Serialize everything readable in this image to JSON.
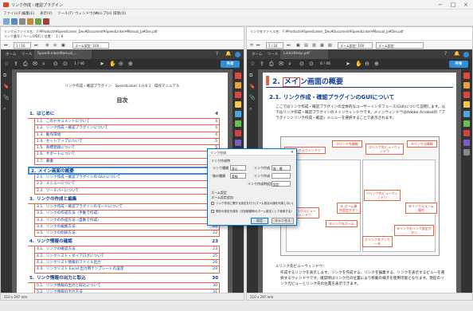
{
  "app": {
    "title": "リンク作成・確認プラグイン",
    "window_controls": [
      "−",
      "□",
      "×"
    ]
  },
  "menu": [
    "ファイル(F)",
    "編集(E)",
    "表示(V)",
    "ツール(T)",
    "ウィンドウ(W)",
    "ヘルプ(H)",
    "環境(O)"
  ],
  "left": {
    "info": [
      "リンク元ファイル名： F:¥Products¥SpeedLinker_Dev¥Document¥SpeedLinker¥Manual_Ja¥Dev.pdf",
      "リンク番号 / ページ(PDF) / 位置 ： 1 / 8"
    ],
    "nav": {
      "page_box": "1 / 16",
      "zoom": "ズーム設定: 100"
    },
    "tabs": {
      "home": "ホーム",
      "tools": "ツール",
      "doc": "SpeedLinkerManual_..."
    },
    "toolbar": {
      "page": "1 / 46",
      "share": "共有"
    },
    "page": {
      "header": "リンク作成・確認プラグイン　SpeedLinker 1.0.6.1　操作マニュアル",
      "toc_title": "目次",
      "toc": [
        {
          "num": "1.",
          "text": "はじめに",
          "page": "4",
          "level": 1
        },
        {
          "num": "1.1.",
          "text": "このドキュメントについて",
          "page": "4",
          "level": 2
        },
        {
          "num": "1.2.",
          "text": "リンク作成・確認プラグインについて",
          "page": "4",
          "level": 2
        },
        {
          "num": "1.3.",
          "text": "動作環境",
          "page": "4",
          "level": 2
        },
        {
          "num": "1.4.",
          "text": "セットアップについて",
          "page": "5",
          "level": 2
        },
        {
          "num": "1.5.",
          "text": "商標登録について",
          "page": "5",
          "level": 2
        },
        {
          "num": "1.6.",
          "text": "サポートについて",
          "page": "5",
          "level": 2
        },
        {
          "num": "1.7.",
          "text": "著書",
          "page": "5",
          "level": 2
        },
        {
          "num": "2.",
          "text": "メイン画面の概要",
          "page": "6",
          "level": 1
        },
        {
          "num": "2.1.",
          "text": "リンク作成・確認プラグインの GUI について",
          "page": "7",
          "level": 2
        },
        {
          "num": "2.2.",
          "text": "メニューについて",
          "page": "11",
          "level": 2
        },
        {
          "num": "2.3.",
          "text": "ツールバーについて",
          "page": "13",
          "level": 2
        },
        {
          "num": "3.",
          "text": "リンクの作成と編集",
          "page": "16",
          "level": 1
        },
        {
          "num": "3.1.",
          "text": "リンク作成・確認プラグインのモードについて",
          "page": "16",
          "level": 2
        },
        {
          "num": "3.2.",
          "text": "リンクの作成方法（手動で作成）",
          "page": "16",
          "level": 2
        },
        {
          "num": "3.3.",
          "text": "リンクの作成方法（自動で作成）",
          "page": "18",
          "level": 2
        },
        {
          "num": "3.4.",
          "text": "リンクの編集方法",
          "page": "20",
          "level": 2
        },
        {
          "num": "3.5.",
          "text": "リンクの削除方法",
          "page": "22",
          "level": 2
        },
        {
          "num": "4.",
          "text": "リンク情報の確認",
          "page": "23",
          "level": 1
        },
        {
          "num": "4.1.",
          "text": "リンクの確認方法",
          "page": "23",
          "level": 2
        },
        {
          "num": "4.2.",
          "text": "リンクリスト・ダイアログについて",
          "page": "25",
          "level": 2
        },
        {
          "num": "4.3.",
          "text": "リンクリスト情報のファイル出力",
          "page": "26",
          "level": 2
        },
        {
          "num": "4.4.",
          "text": "リンクリスト Excel 出力用テンプレートの設定",
          "page": "29",
          "level": 2
        },
        {
          "num": "5.",
          "text": "リンク情報の出力と取込",
          "page": "30",
          "level": 1
        },
        {
          "num": "5.1.",
          "text": "リンク情報の出力と取込について",
          "page": "30",
          "level": 2
        },
        {
          "num": "5.2.",
          "text": "リンク情報の出力方法",
          "page": "31",
          "level": 2
        }
      ]
    },
    "status": "210 x 297 mm"
  },
  "right": {
    "info": [
      "リンク先ファイル名： F:¥Products¥SpeedLinker_Dev¥Document¥SpeedLinker¥Manual_Ja¥Dev.pdf"
    ],
    "nav": {
      "page_box": "1 / 16",
      "zoom": "ズーム設定: 100",
      "zoom2": "ズーム設定"
    },
    "tabs": {
      "home": "ホーム",
      "tools": "ツール",
      "doc": "LinkUIHelp.pdf"
    },
    "toolbar": {
      "page": "6 / 46",
      "share": "共有"
    },
    "page": {
      "h1_num": "2.",
      "h1_boxed": "メイ",
      "h1_rest": "ン画面の概要",
      "h2": "2.1. リンク作成・確認プラグインのGUIについて",
      "para": "ここではリンク作成・確認プラグインの全体的なユーザーインタフェース(GUI)について説明します。以下はリンク作成・確認プラグインのメインウィンドウです。メインウィンドウはAdobe Acrobatの「プラグイン＞リンク作成・確認」メニューを選択することで表示されます。",
      "callouts": [
        "①リンク先情報",
        "③リンク元ウィンドウ",
        "②リンク先ビューウィンドウ",
        "④リンク元情報",
        "⑤リンク元ビューウィンドウ",
        "⑥ ズーム操作設定ボタン",
        "⑦リンク先ビューウィンドウ",
        "⑧リンク元ズーム操作",
        "⑨リンク先ズーム",
        "⑩リンク先リンク設定ボタン",
        "⑪リンク先アンカー名"
      ],
      "bullets_title": "①リンク先ビューウィンドウ：",
      "bullets": "作成するリンクを表示します。リンクを作成する、リンクを編集する、リンクを表示するビューを選択するウィンドウです。確認時はリンク元の位置により移動の様子を使用可能となります。現在のリンク元ビューとリンク先の位置を表示できます。"
    },
    "status": "210 x 297 mm"
  },
  "dialog": {
    "title": "リンク作成",
    "group1": "リンク作成時",
    "row1_label": "リンク種類",
    "row1_value": "表示",
    "row1b_label": "リンク作成",
    "row1b_value": "縦・横",
    "row2_label": "線の種類",
    "row2_value": "実線",
    "row2b_label": "リンク作成",
    "row2b_value": "",
    "row3b_label": "リンク作成時設定",
    "row3b_value": "設定",
    "group2": "ズーム設定",
    "zoom_note": "ズーム設定追加",
    "check1": "リンク作成に関する設定を行う(ズーム設定の値を利用しない)",
    "check2": "現在の設定を保存（次回起動時のズーム設定として使用する）",
    "ok": "設定",
    "cancel": "キャンセル"
  }
}
